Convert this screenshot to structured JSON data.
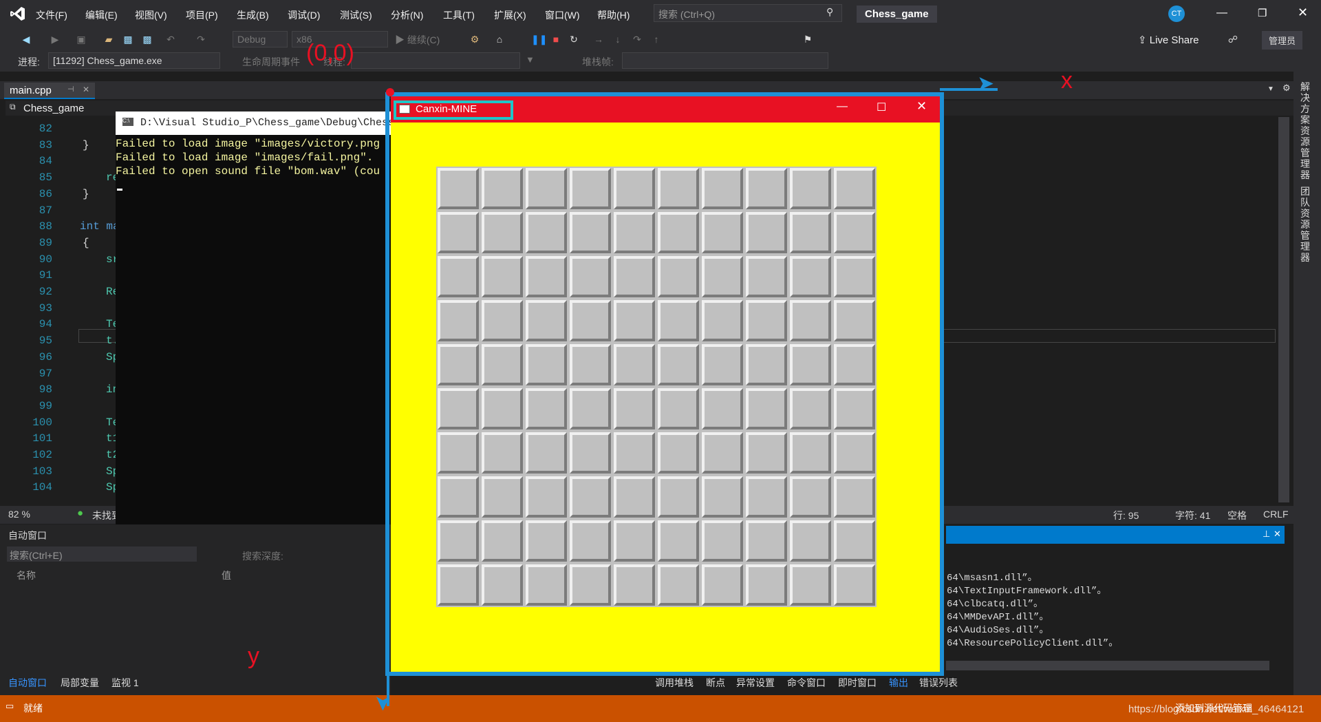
{
  "menu": [
    "文件(F)",
    "编辑(E)",
    "视图(V)",
    "项目(P)",
    "生成(B)",
    "调试(D)",
    "测试(S)",
    "分析(N)",
    "工具(T)",
    "扩展(X)",
    "窗口(W)",
    "帮助(H)"
  ],
  "search": {
    "placeholder": "搜索 (Ctrl+Q)"
  },
  "solution_name": "Chess_game",
  "user_initials": "CT",
  "toolbar": {
    "config": "Debug",
    "platform": "x86",
    "continue": "继续(C)",
    "live_share": "Live Share",
    "admin": "管理员"
  },
  "debug_bar": {
    "process_label": "进程:",
    "process": "[11292] Chess_game.exe",
    "lifecycle": "生命周期事件",
    "thread": "线程:",
    "stack": "堆栈帧:"
  },
  "tabs": {
    "file": "main.cpp",
    "nav_project": "Chess_game"
  },
  "side_panel": {
    "solution_explorer": "解决方案资源管理器",
    "team_explorer": "团队资源管理器"
  },
  "editor": {
    "line_numbers": [
      "82",
      "83",
      "84",
      "85",
      "86",
      "87",
      "88",
      "89",
      "90",
      "91",
      "92",
      "93",
      "94",
      "95",
      "96",
      "97",
      "98",
      "99",
      "100",
      "101",
      "102",
      "103",
      "104"
    ],
    "code_lines": [
      "",
      "}",
      "",
      "re",
      "}",
      "",
      "int ma",
      "{",
      "sr",
      "",
      "Re",
      "",
      "Te",
      "t.",
      "Sp",
      "",
      "in",
      "",
      "Te",
      "t1",
      "t2",
      "Sp",
      "Sp"
    ],
    "zoom": "82 %",
    "issues": "未找到",
    "status_line": "行: 95",
    "status_char": "字符: 41",
    "status_space": "空格",
    "status_eol": "CRLF"
  },
  "console": {
    "title": "D:\\Visual Studio_P\\Chess_game\\Debug\\Chess_gam",
    "lines": [
      "Failed to load image \"images/victory.png",
      "Failed to load image \"images/fail.png\".",
      "Failed to open sound file \"bom.wav\" (cou"
    ]
  },
  "game": {
    "title": "Canxin-MINE",
    "rows": 10,
    "cols": 10
  },
  "annotations": {
    "origin": "(0,0)",
    "x": "x",
    "y": "y"
  },
  "autos": {
    "title": "自动窗口",
    "search_placeholder": "搜索(Ctrl+E)",
    "depth": "搜索深度:",
    "col_name": "名称",
    "col_value": "值",
    "tabs": [
      "自动窗口",
      "局部变量",
      "监视 1"
    ]
  },
  "output": {
    "lines": [
      "64\\msasn1.dll”。",
      "64\\TextInputFramework.dll”。",
      "64\\clbcatq.dll”。",
      "64\\MMDevAPI.dll”。",
      "64\\AudioSes.dll”。",
      "64\\ResourcePolicyClient.dll”。"
    ],
    "tabs": [
      "调用堆栈",
      "断点",
      "异常设置",
      "命令窗口",
      "即时窗口",
      "输出",
      "错误列表"
    ]
  },
  "statusbar": {
    "ready": "就绪",
    "add_source": "添加到源代码管理",
    "watermark": "https://blog.csdn.net/weixin_46464121"
  },
  "colors": {
    "accent": "#007acc",
    "status": "#ca5100",
    "game_bg": "#ffff00",
    "game_title": "#e81123",
    "annotation": "#1e90d6",
    "annotation_text": "#e81123"
  }
}
